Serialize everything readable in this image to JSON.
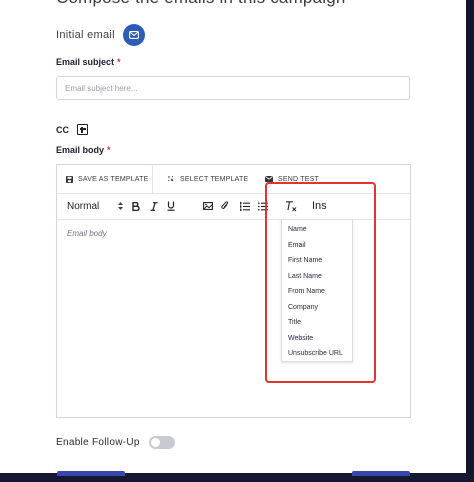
{
  "page": {
    "title": "Compose the emails in this campaign"
  },
  "initial_email": {
    "label": "Initial email",
    "icon": "envelope-icon"
  },
  "subject": {
    "label": "Email subject",
    "required_mark": "*",
    "placeholder": "Email subject here...",
    "value": ""
  },
  "cc": {
    "label": "CC",
    "add_icon": "plus-square-icon"
  },
  "body": {
    "label": "Email body",
    "required_mark": "*",
    "placeholder": "Email body",
    "actions": {
      "save_template": "SAVE AS TEMPLATE",
      "select_template": "SELECT TEMPLATE",
      "send_test": "SEND TEST"
    },
    "toolbar": {
      "format_select": "Normal",
      "insert_label": "Ins",
      "tools": [
        "bold-icon",
        "italic-icon",
        "underline-icon",
        "image-icon",
        "attachment-icon",
        "ordered-list-icon",
        "bullet-list-icon",
        "clear-format-icon"
      ]
    },
    "insert_menu": [
      "Name",
      "Email",
      "First Name",
      "Last Name",
      "From Name",
      "Company",
      "Title",
      "Website",
      "Unsubscribe URL"
    ]
  },
  "followup": {
    "label": "Enable Follow-Up",
    "enabled": false
  },
  "colors": {
    "accent": "#2d5bb8",
    "highlight": "#e0342f",
    "required": "#d2344a",
    "dark_bar": "#161730"
  }
}
